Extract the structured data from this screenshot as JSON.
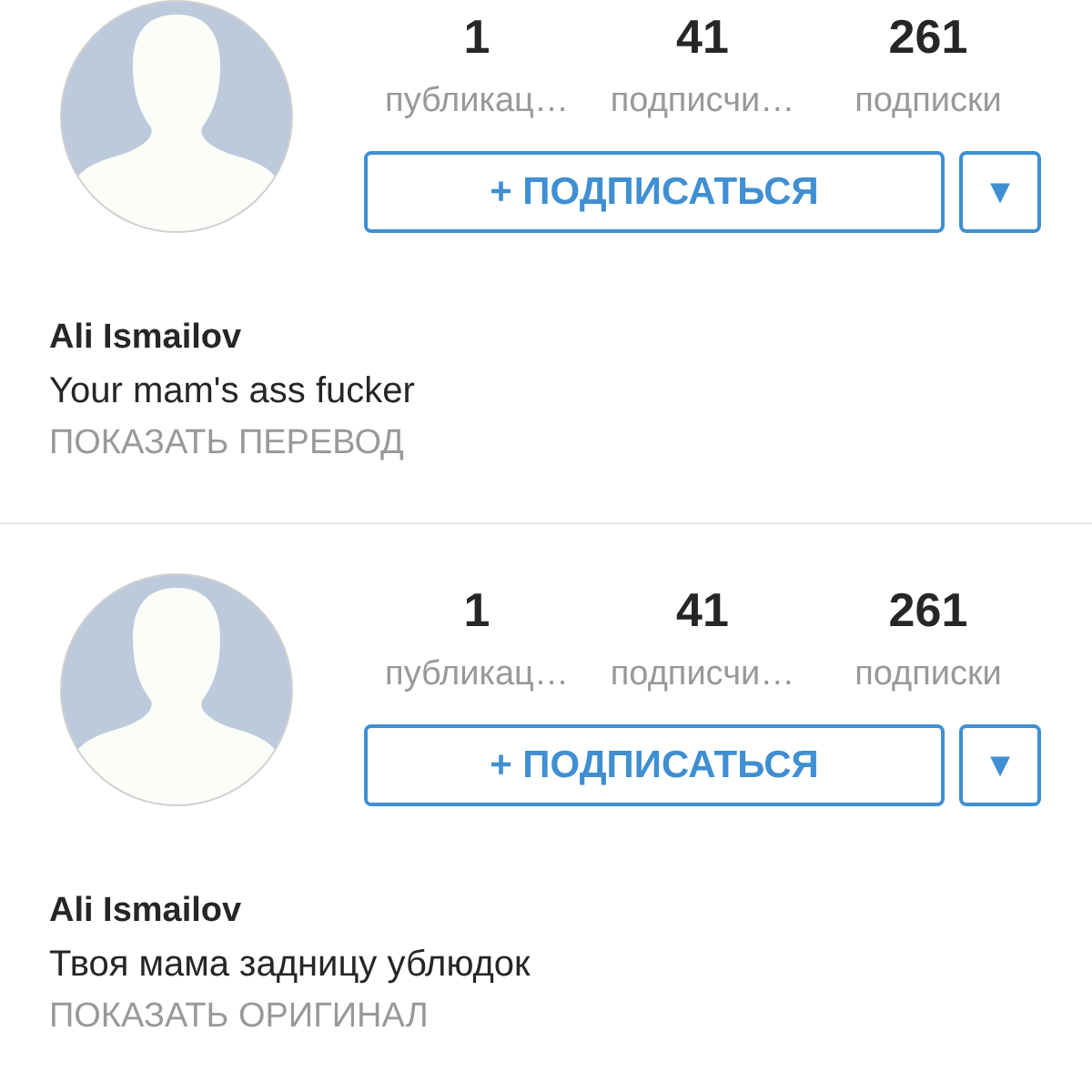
{
  "profiles": [
    {
      "stats": [
        {
          "value": "1",
          "label": "публикац…"
        },
        {
          "value": "41",
          "label": "подписчи…"
        },
        {
          "value": "261",
          "label": "подписки"
        }
      ],
      "follow_button": "+ ПОДПИСАТЬСЯ",
      "dropdown_button": "▾",
      "name": "Ali Ismailov",
      "bio": "Your mam's ass fucker",
      "translate_link": "ПОКАЗАТЬ ПЕРЕВОД"
    },
    {
      "stats": [
        {
          "value": "1",
          "label": "публикац…"
        },
        {
          "value": "41",
          "label": "подписчи…"
        },
        {
          "value": "261",
          "label": "подписки"
        }
      ],
      "follow_button": "+ ПОДПИСАТЬСЯ",
      "dropdown_button": "▾",
      "name": "Ali Ismailov",
      "bio": "Твоя мама задницу ублюдок",
      "translate_link": "ПОКАЗАТЬ ОРИГИНАЛ"
    }
  ]
}
